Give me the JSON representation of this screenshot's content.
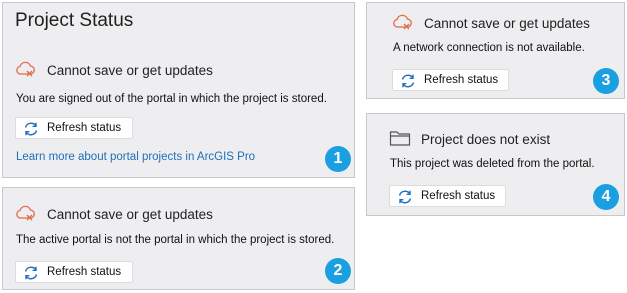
{
  "colors": {
    "panel_background": "#eeeef0",
    "panel_border": "#c8c8cc",
    "error_icon": "#e06a4a",
    "link": "#1d6fb8",
    "badge": "#1aa0e0",
    "refresh_icon": "#1e6fbf"
  },
  "panel1": {
    "title": "Project Status",
    "icon": "cloud-error-icon",
    "heading": "Cannot save or get updates",
    "message": "You are signed out of the portal in which the project is stored.",
    "button_label": "Refresh status",
    "link_text": "Learn more about portal projects in ArcGIS Pro",
    "badge": "1"
  },
  "panel2": {
    "icon": "cloud-error-icon",
    "heading": "Cannot save or get updates",
    "message": "The active portal is not the portal in which the project is stored.",
    "button_label": "Refresh status",
    "badge": "2"
  },
  "panel3": {
    "icon": "cloud-error-icon",
    "heading": "Cannot save or get updates",
    "message": "A network connection is not available.",
    "button_label": "Refresh status",
    "badge": "3"
  },
  "panel4": {
    "icon": "folder-icon",
    "heading": "Project does not exist",
    "message": "This project was deleted from the portal.",
    "button_label": "Refresh status",
    "badge": "4"
  }
}
